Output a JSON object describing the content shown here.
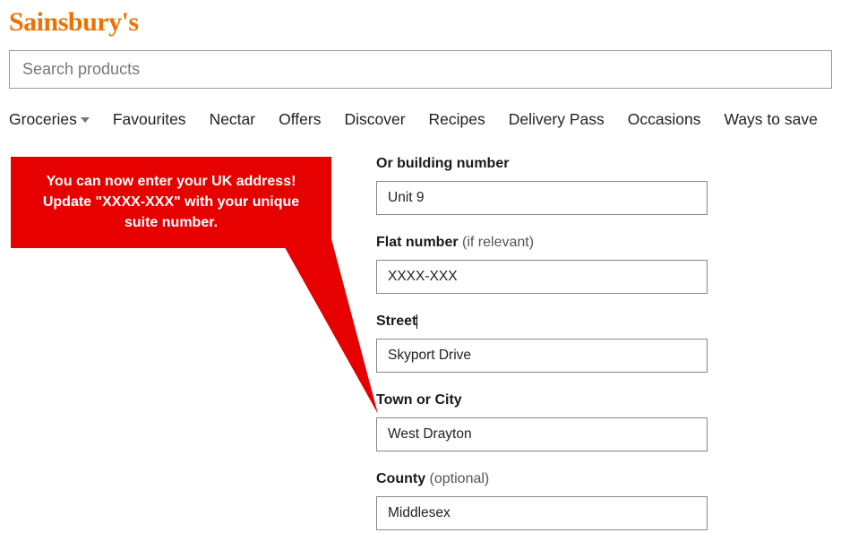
{
  "logo": "Sainsbury's",
  "search": {
    "placeholder": "Search products"
  },
  "nav": {
    "groceries": "Groceries",
    "favourites": "Favourites",
    "nectar": "Nectar",
    "offers": "Offers",
    "discover": "Discover",
    "recipes": "Recipes",
    "delivery_pass": "Delivery Pass",
    "occasions": "Occasions",
    "ways_to_save": "Ways to save"
  },
  "callout": {
    "text": "You can now enter your UK address! Update \"XXXX-XXX\" with your unique suite number."
  },
  "form": {
    "building": {
      "label": "Or building number",
      "value": "Unit 9"
    },
    "flat": {
      "label": "Flat number ",
      "hint": "(if relevant)",
      "value": "XXXX-XXX"
    },
    "street": {
      "label": "Street",
      "value": "Skyport Drive"
    },
    "town": {
      "label": "Town or City",
      "value": "West Drayton"
    },
    "county": {
      "label": "County ",
      "hint": "(optional)",
      "value": "Middlesex"
    }
  }
}
